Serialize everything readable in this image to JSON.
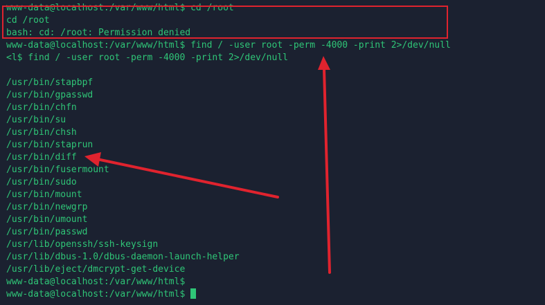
{
  "terminal": {
    "lines": [
      "www-data@localhost:/var/www/html$ cd /root",
      "cd /root",
      "bash: cd: /root: Permission denied",
      "www-data@localhost:/var/www/html$ find / -user root -perm -4000 -print 2>/dev/null",
      "<l$ find / -user root -perm -4000 -print 2>/dev/null",
      "",
      "/usr/bin/stapbpf",
      "/usr/bin/gpasswd",
      "/usr/bin/chfn",
      "/usr/bin/su",
      "/usr/bin/chsh",
      "/usr/bin/staprun",
      "/usr/bin/diff",
      "/usr/bin/fusermount",
      "/usr/bin/sudo",
      "/usr/bin/mount",
      "/usr/bin/newgrp",
      "/usr/bin/umount",
      "/usr/bin/passwd",
      "/usr/lib/openssh/ssh-keysign",
      "/usr/lib/dbus-1.0/dbus-daemon-launch-helper",
      "/usr/lib/eject/dmcrypt-get-device",
      "www-data@localhost:/var/www/html$",
      "www-data@localhost:/var/www/html$ "
    ]
  },
  "colors": {
    "background": "#1b2130",
    "text": "#2fc577",
    "annotation": "#e0232e"
  },
  "annotations": {
    "box_target": "permission-denied-output",
    "arrow_1_target": "/usr/bin/diff",
    "arrow_2_target": "find-command-line"
  }
}
